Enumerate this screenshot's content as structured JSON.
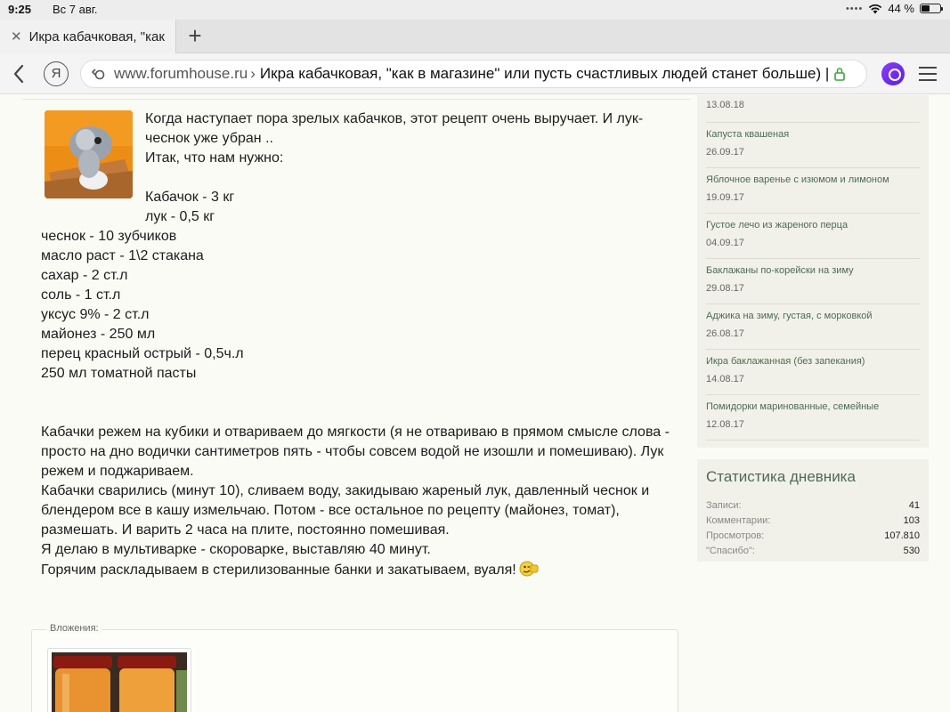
{
  "status_bar": {
    "time": "9:25",
    "date": "Вс 7 авг.",
    "battery": "44 %",
    "battery_level": 0.44
  },
  "browser": {
    "tab_title": "Икра кабачковая, \"как",
    "url_domain": "www.forumhouse.ru",
    "url_separator": "›",
    "url_page_title": "Икра кабачковая, \"как в магазине\" или пусть счастливых людей станет больше) |",
    "yandex_letter": "Я"
  },
  "post": {
    "lines_indented": [
      "Когда наступает пора зрелых кабачков, этот рецепт очень выручает. И лук-",
      "чеснок уже убран ..",
      "Итак, что нам нужно:",
      "",
      "Кабачок - 3 кг",
      "лук - 0,5 кг"
    ],
    "lines_full": [
      "чеснок - 10 зубчиков",
      "масло раст - 1\\2 стакана",
      "сахар - 2 ст.л",
      "соль - 1 ст.л",
      "уксус 9% - 2 ст.л",
      "майонез - 250 мл",
      "перец красный острый - 0,5ч.л",
      "250 мл томатной пасты",
      "",
      "",
      "Кабачки режем на кубики и отвариваем до мягкости (я не отвариваю в прямом смысле слова -",
      "просто на дно водички сантиметров пять - чтобы совсем водой не изошли и помешиваю). Лук",
      "режем и поджариваем.",
      "Кабачки сварились (минут 10), сливаем воду, закидываю жареный лук, давленный чеснок и",
      "блендером все в кашу измельчаю. Потом - все остальное по рецепту (майонез, томат),",
      "размешать. И варить 2 часа на плите, постоянно помешивая.",
      "Я делаю в мультиварке - скороварке, выставляю 40 минут.",
      "Горячим раскладываем в стерилизованные банки и закатываем, вуаля!"
    ],
    "attachments_label": "Вложения:"
  },
  "sidebar": {
    "recent": [
      {
        "title": "",
        "date": "13.08.18"
      },
      {
        "title": "Капуста квашеная",
        "date": "26.09.17"
      },
      {
        "title": "Яблочное варенье с изюмом и лимоном",
        "date": "19.09.17"
      },
      {
        "title": "Густое лечо из жареного перца",
        "date": "04.09.17"
      },
      {
        "title": "Баклажаны по-корейски на зиму",
        "date": "29.08.17"
      },
      {
        "title": "Аджика на зиму, густая, с морковкой",
        "date": "26.08.17"
      },
      {
        "title": "Икра баклажанная (без запекания)",
        "date": "14.08.17"
      },
      {
        "title": "Помидорки маринованные, семейные",
        "date": "12.08.17"
      }
    ],
    "stats": {
      "title": "Статистика дневника",
      "rows": [
        {
          "label": "Записи:",
          "value": "41"
        },
        {
          "label": "Комментарии:",
          "value": "103"
        },
        {
          "label": "Просмотров:",
          "value": "107.810"
        },
        {
          "label": "\"Спасибо\":",
          "value": "530"
        }
      ]
    }
  },
  "colors": {
    "sidebar_link": "#4e6b52",
    "page_bg": "#fbfbf6",
    "sidebar_bg": "#f1f1ea"
  }
}
